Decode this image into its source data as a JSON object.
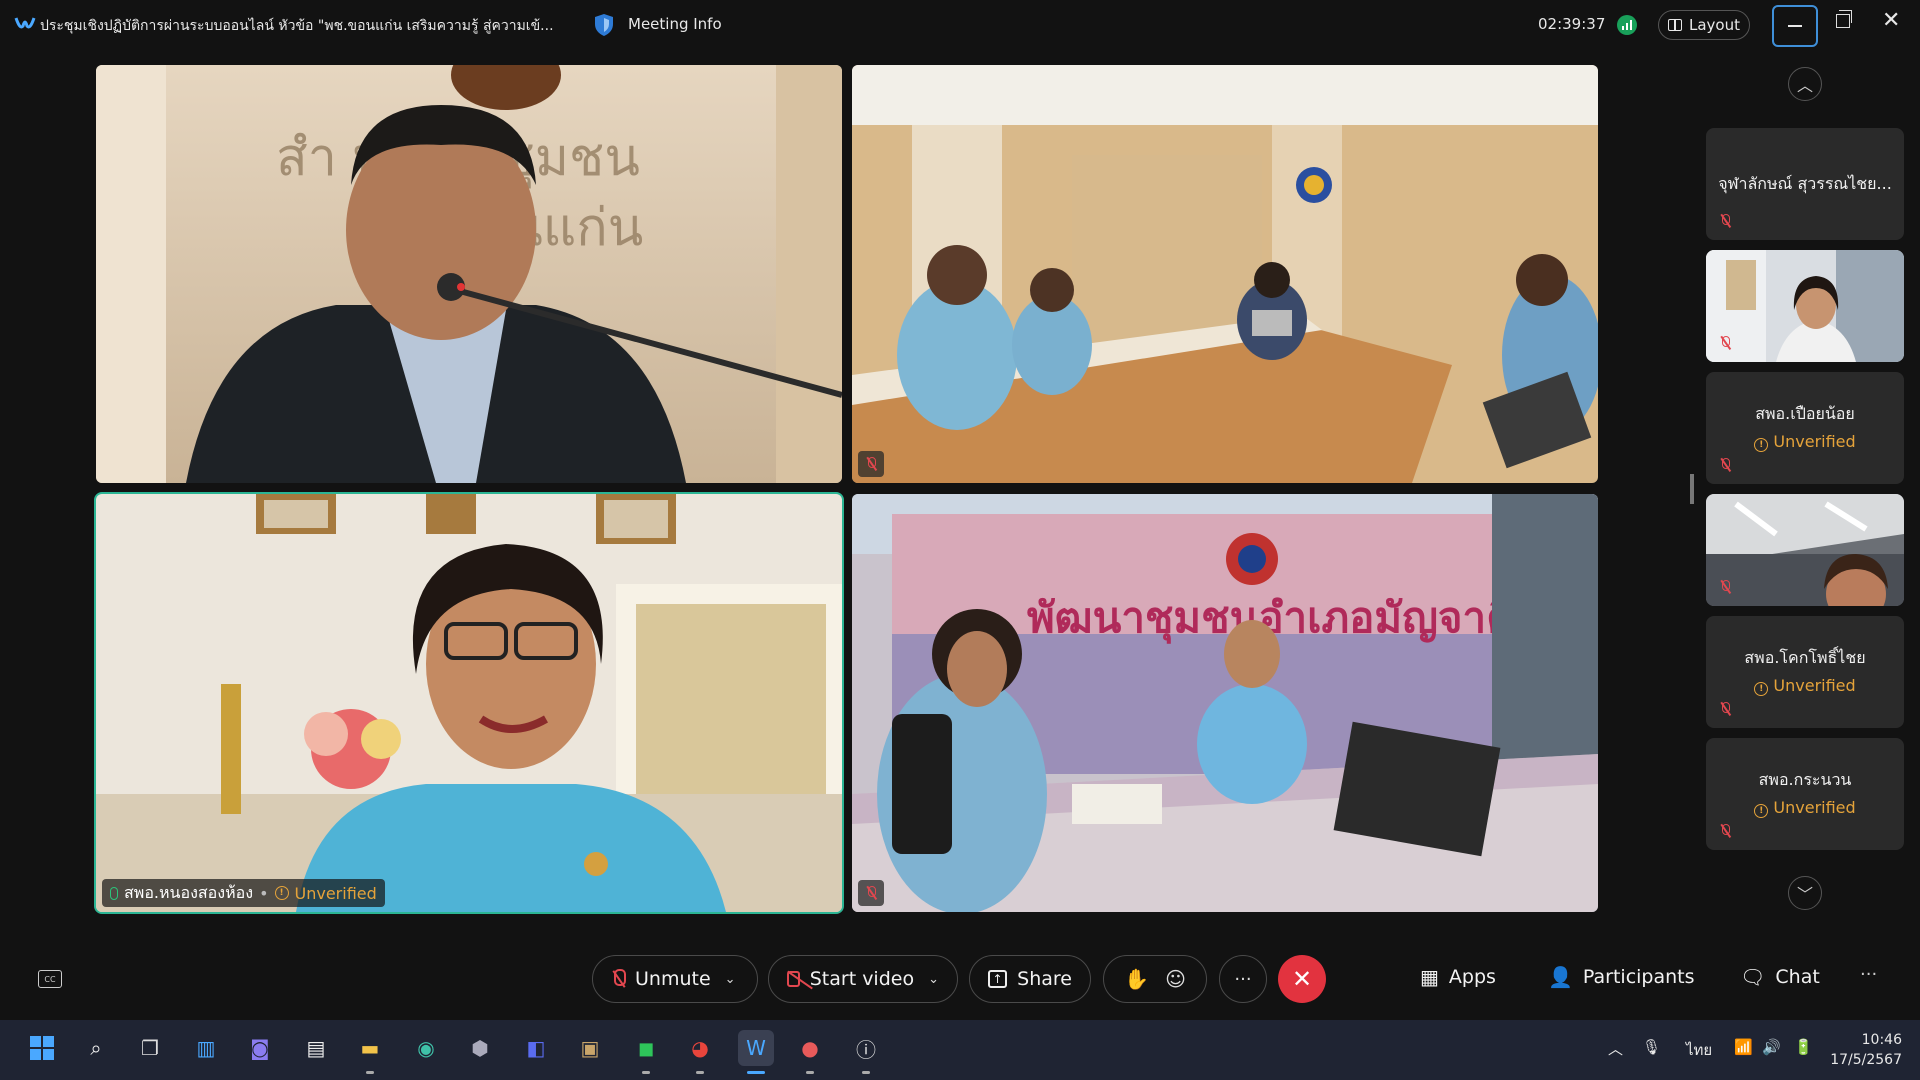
{
  "titlebar": {
    "meeting_title": "ประชุมเชิงปฏิบัติการผ่านระบบออนไลน์  หัวข้อ \"พช.ขอนแก่น เสริมความรู้ สู่ความเข้...",
    "meeting_info_label": "Meeting Info",
    "elapsed_time": "02:39:37",
    "layout_label": "Layout"
  },
  "video_tiles": [
    {
      "id": "speaker-1",
      "muted": false,
      "has_label": false
    },
    {
      "id": "conference-room",
      "muted": true,
      "has_label": false
    },
    {
      "id": "active-speaker",
      "muted": false,
      "name": "สพอ.หนองสองห้อง",
      "separator": "•",
      "status": "Unverified"
    },
    {
      "id": "community-office",
      "muted": true,
      "has_label": false
    }
  ],
  "side_panel": {
    "participants": [
      {
        "name": "จุฬาลักษณ์ สุวรรณไชย...",
        "status": "",
        "video": false
      },
      {
        "name": "",
        "status": "",
        "video": true
      },
      {
        "name": "สพอ.เปือยน้อย",
        "status": "Unverified",
        "video": false
      },
      {
        "name": "",
        "status": "",
        "video": true
      },
      {
        "name": "สพอ.โคกโพธิ์ไชย",
        "status": "Unverified",
        "video": false
      },
      {
        "name": "สพอ.กระนวน",
        "status": "Unverified",
        "video": false
      }
    ]
  },
  "toolbar": {
    "unmute_label": "Unmute",
    "start_video_label": "Start video",
    "share_label": "Share",
    "more_label": "···",
    "apps_label": "Apps",
    "participants_label": "Participants",
    "chat_label": "Chat",
    "overflow_label": "···"
  },
  "taskbar": {
    "language": "ไทย",
    "time": "10:46",
    "date": "17/5/2567"
  },
  "colors": {
    "accent_active_speaker": "#2bb594",
    "hangup": "#e2333f",
    "muted_icon": "#e2474f",
    "unverified": "#e5a33a"
  }
}
